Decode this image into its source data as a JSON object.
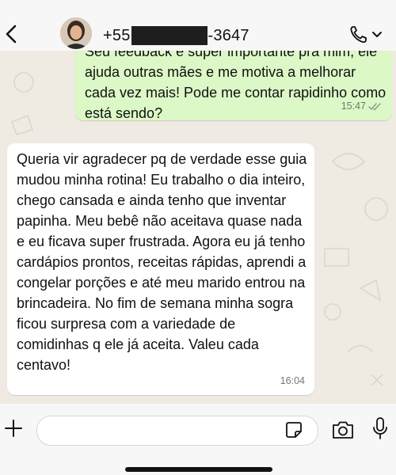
{
  "header": {
    "contact_prefix": "+55",
    "contact_suffix": "-3647"
  },
  "messages": [
    {
      "direction": "outgoing",
      "text": "Seu feedback é super importante pra mim, ele ajuda outras mães e me motiva a melhorar cada vez mais! Pode me contar rapidinho como está sendo?",
      "time": "15:47",
      "status_icon": "double-check-icon"
    },
    {
      "direction": "incoming",
      "text": "Queria vir agradecer pq de verdade esse guia mudou minha rotina! Eu trabalho o dia inteiro, chego cansada e ainda tenho que inventar papinha. Meu bebê não aceitava quase nada e eu ficava super frustrada. Agora eu já tenho cardápios prontos, receitas rápidas, aprendi a congelar porções e até meu marido entrou na brincadeira. No fim de semana minha sogra ficou surpresa com a variedade de comidinhas q ele já aceita. Valeu cada centavo!",
      "time": "16:04"
    }
  ],
  "composer": {
    "placeholder": ""
  },
  "icons": {
    "back": "chevron-left-icon",
    "call": "phone-icon",
    "call_menu": "chevron-down-icon",
    "attach": "plus-icon",
    "sticker": "sticker-icon",
    "camera": "camera-icon",
    "mic": "microphone-icon"
  },
  "colors": {
    "outgoing_bubble": "#dcf8c6",
    "incoming_bubble": "#ffffff",
    "chat_background": "#efeae2",
    "read_tick": "#8a9a8a"
  }
}
